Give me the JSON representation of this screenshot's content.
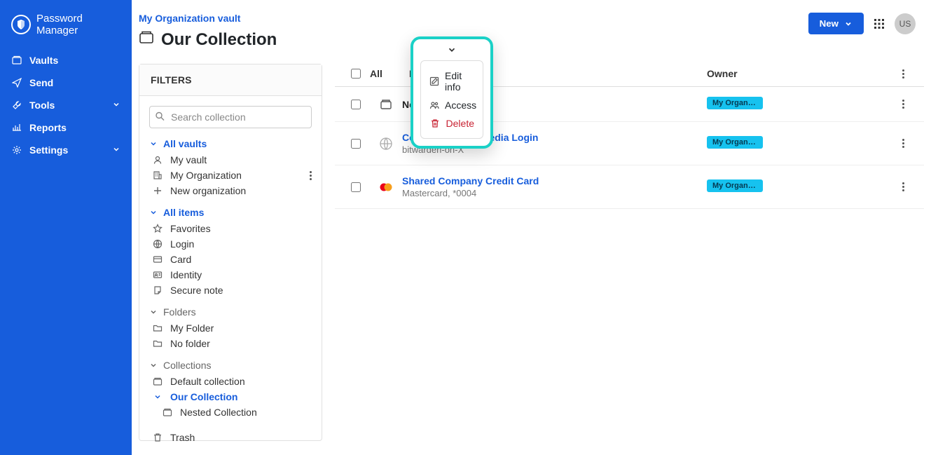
{
  "brand": "Password Manager",
  "avatar": "US",
  "nav": {
    "vaults": "Vaults",
    "send": "Send",
    "tools": "Tools",
    "reports": "Reports",
    "settings": "Settings"
  },
  "header": {
    "breadcrumb": "My Organization vault",
    "title": "Our Collection",
    "new_btn": "New"
  },
  "popover": {
    "edit_info": "Edit info",
    "access": "Access",
    "delete": "Delete"
  },
  "filters": {
    "heading": "FILTERS",
    "search_placeholder": "Search collection",
    "all_vaults": "All vaults",
    "my_vault": "My vault",
    "my_org": "My Organization",
    "new_org": "New organization",
    "all_items": "All items",
    "favorites": "Favorites",
    "login": "Login",
    "card": "Card",
    "identity": "Identity",
    "secure_note": "Secure note",
    "folders": "Folders",
    "my_folder": "My Folder",
    "no_folder": "No folder",
    "collections": "Collections",
    "default_collection": "Default collection",
    "our_collection": "Our Collection",
    "nested_collection": "Nested Collection",
    "trash": "Trash"
  },
  "table": {
    "col_all": "All",
    "col_name": "Name",
    "col_owner": "Owner",
    "owner_badge": "My Organiz...",
    "rows": {
      "r0": {
        "name": "Nested Collection"
      },
      "r1": {
        "name": "Company Social Media Login",
        "sub": "bitwarden-on-X"
      },
      "r2": {
        "name": "Shared Company Credit Card",
        "sub": "Mastercard, *0004"
      }
    }
  }
}
